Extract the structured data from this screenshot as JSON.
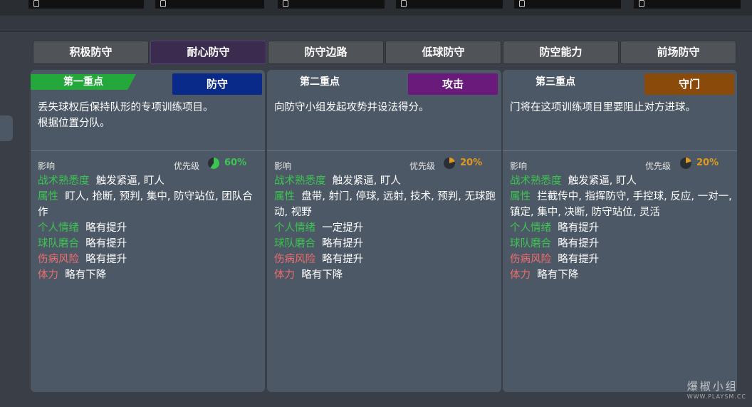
{
  "tabs": [
    {
      "label": "积极防守",
      "active": false
    },
    {
      "label": "耐心防守",
      "active": true
    },
    {
      "label": "防守边路",
      "active": false
    },
    {
      "label": "低球防守",
      "active": false
    },
    {
      "label": "防空能力",
      "active": false
    },
    {
      "label": "前场防守",
      "active": false
    }
  ],
  "cards": [
    {
      "focus": "第一重点",
      "category": "防守",
      "category_color": "#0a2a8a",
      "desc_lines": [
        "丢失球权后保持队形的专项训练项目。",
        "根据位置分队。"
      ],
      "impact_label": "影响",
      "priority_label": "优先级",
      "priority_pct": "60%",
      "priority_value": 0.6,
      "pct_color": "#3cc451",
      "familiarity_key": "战术熟悉度",
      "familiarity_val": "触发紧逼, 盯人",
      "attr_key": "属性",
      "attr_val": "盯人, 抢断, 预判, 集中, 防守站位, 团队合作",
      "morale_key": "个人情绪",
      "morale_val": "略有提升",
      "cohesion_key": "球队磨合",
      "cohesion_val": "略有提升",
      "injury_key": "伤病风险",
      "injury_val": "略有提升",
      "stamina_key": "体力",
      "stamina_val": "略有下降"
    },
    {
      "focus": "第二重点",
      "category": "攻击",
      "category_color": "#6a1a7a",
      "desc_lines": [
        "向防守小组发起攻势并设法得分。"
      ],
      "impact_label": "影响",
      "priority_label": "优先级",
      "priority_pct": "20%",
      "priority_value": 0.2,
      "pct_color": "#e09a1a",
      "familiarity_key": "战术熟悉度",
      "familiarity_val": "触发紧逼, 盯人",
      "attr_key": "属性",
      "attr_val": "盘带, 射门, 停球, 远射, 技术, 预判, 无球跑动, 视野",
      "morale_key": "个人情绪",
      "morale_val": "一定提升",
      "cohesion_key": "球队磨合",
      "cohesion_val": "略有提升",
      "injury_key": "伤病风险",
      "injury_val": "略有提升",
      "stamina_key": "体力",
      "stamina_val": "略有下降"
    },
    {
      "focus": "第三重点",
      "category": "守门",
      "category_color": "#8a4a0a",
      "desc_lines": [
        "门将在这项训练项目里要阻止对方进球。"
      ],
      "impact_label": "影响",
      "priority_label": "优先级",
      "priority_pct": "20%",
      "priority_value": 0.2,
      "pct_color": "#e09a1a",
      "familiarity_key": "战术熟悉度",
      "familiarity_val": "触发紧逼, 盯人",
      "attr_key": "属性",
      "attr_val": "拦截传中, 指挥防守, 手控球, 反应, 一对一, 镇定, 集中, 决断, 防守站位, 灵活",
      "morale_key": "个人情绪",
      "morale_val": "略有提升",
      "cohesion_key": "球队磨合",
      "cohesion_val": "略有提升",
      "injury_key": "伤病风险",
      "injury_val": "略有提升",
      "stamina_key": "体力",
      "stamina_val": "略有下降"
    }
  ],
  "watermark": {
    "text": "爆椒小组",
    "sub": "WWW.PLAYSM.CC"
  }
}
